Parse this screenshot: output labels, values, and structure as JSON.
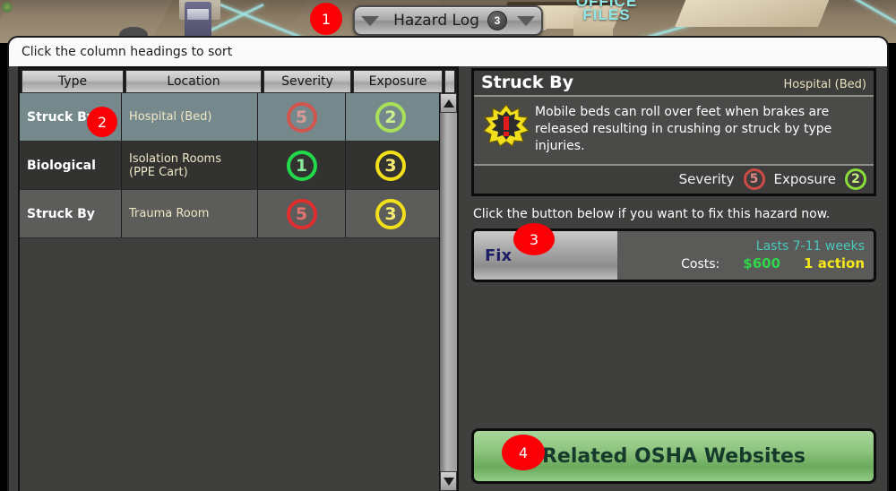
{
  "scene": {
    "office_files_label": "OFFICE\nFILES"
  },
  "title_bar": {
    "left_arrow_icon": "chevron-down-icon",
    "title": "Hazard Log",
    "badge_count": "3",
    "right_arrow_icon": "chevron-down-icon"
  },
  "window": {
    "hint": "Click the column headings to sort"
  },
  "table": {
    "columns": [
      "Type",
      "Location",
      "Severity",
      "Exposure"
    ],
    "rows": [
      {
        "type": "Struck By",
        "location": "Hospital (Bed)",
        "severity": "5",
        "exposure": "2",
        "selected": true
      },
      {
        "type": "Biological",
        "location": "Isolation Rooms (PPE Cart)",
        "severity": "1",
        "exposure": "3",
        "selected": false
      },
      {
        "type": "Struck By",
        "location": "Trauma Room",
        "severity": "5",
        "exposure": "3",
        "selected": false
      }
    ]
  },
  "scrollbar": {
    "up_icon": "triangle-up-icon",
    "down_icon": "triangle-down-icon"
  },
  "detail": {
    "title": "Struck By",
    "location": "Hospital (Bed)",
    "warning_icon": "warning-burst-icon",
    "description": "Mobile beds can roll over feet when brakes are released resulting in crushing or struck by type injuries.",
    "severity_label": "Severity",
    "severity_value": "5",
    "exposure_label": "Exposure",
    "exposure_value": "2"
  },
  "fix": {
    "hint": "Click the button below if you want to fix this hazard now.",
    "button_label": "Fix",
    "lasts": "Lasts 7-11 weeks",
    "costs_label": "Costs:",
    "money": "$600",
    "action": "1 action"
  },
  "osha": {
    "label": "Related OSHA Websites"
  },
  "markers": {
    "m1": "1",
    "m2": "2",
    "m3": "3",
    "m4": "4"
  },
  "colors": {
    "marker_red": "#fb0007",
    "severity_red": "#e02d2d",
    "severity_green": "#21d94a",
    "exposure_light_green": "#8bdc3b",
    "exposure_yellow": "#f2e019",
    "money_green": "#2fd64a",
    "action_yellow": "#f5e61e",
    "lasts_teal": "#49c7bd",
    "selected_row": "#75898c",
    "osha_green": "#8dc47e",
    "panel_dark": "#3f3f3d"
  }
}
